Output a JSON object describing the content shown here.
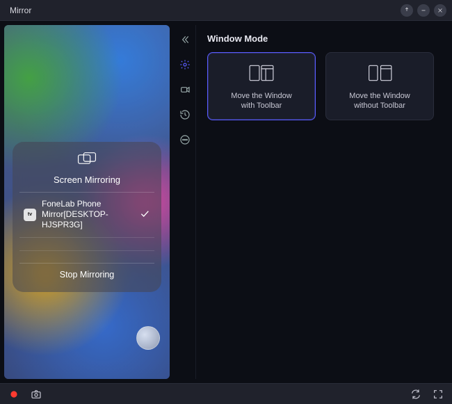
{
  "titlebar": {
    "app_name": "Mirror"
  },
  "settings": {
    "section_title": "Window Mode",
    "mode_a_label": "Move the Window with Toolbar",
    "mode_b_label": "Move the Window without Toolbar"
  },
  "control_center": {
    "title": "Screen Mirroring",
    "device_badge": "tv",
    "device_name": "FoneLab Phone Mirror[DESKTOP-HJSPR3G]",
    "stop_label": "Stop Mirroring"
  }
}
